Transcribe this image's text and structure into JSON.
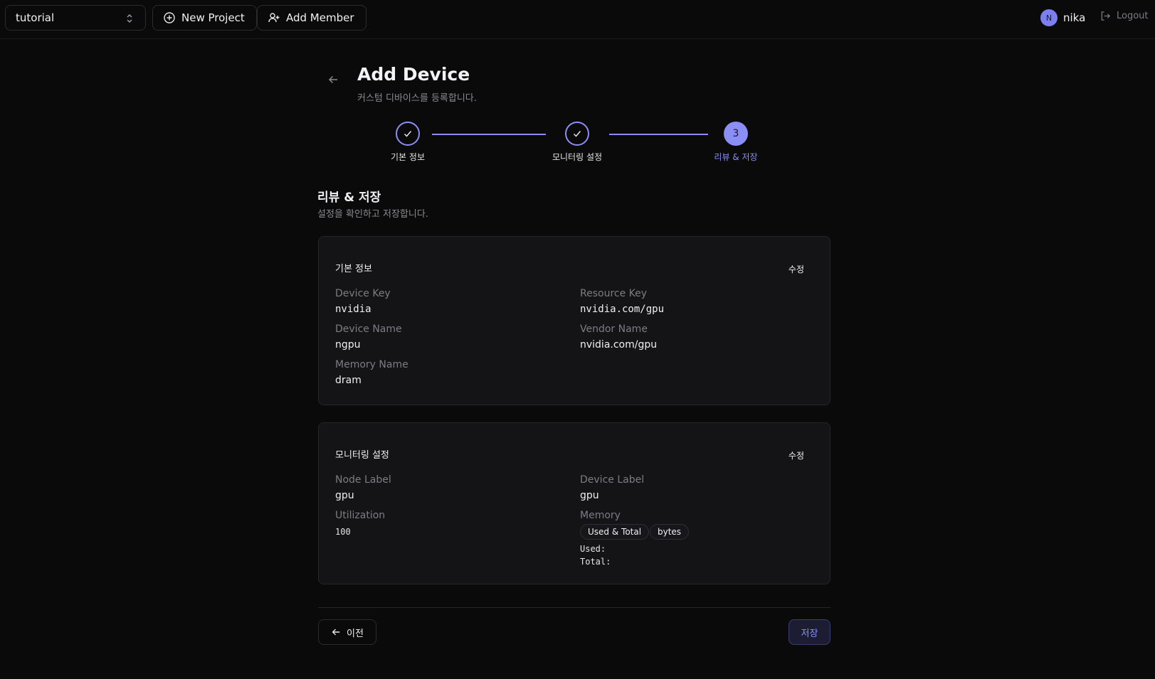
{
  "topbar": {
    "project": "tutorial",
    "new_project_label": "New Project",
    "add_member_label": "Add Member",
    "user_initial": "N",
    "user_name": "nika",
    "logout_label": "Logout"
  },
  "header": {
    "title": "Add Device",
    "subtitle": "커스텀 디바이스를 등록합니다."
  },
  "stepper": {
    "steps": [
      {
        "label": "기본 정보",
        "status": "done"
      },
      {
        "label": "모니터링 설정",
        "status": "done"
      },
      {
        "label": "리뷰 & 저장",
        "status": "active",
        "number": "3"
      }
    ]
  },
  "section": {
    "title": "리뷰 & 저장",
    "subtitle": "설정을 확인하고 저장합니다."
  },
  "basic": {
    "title": "기본 정보",
    "edit_label": "수정",
    "device_key_label": "Device Key",
    "device_key": "nvidia",
    "resource_key_label": "Resource Key",
    "resource_key": "nvidia.com/gpu",
    "device_name_label": "Device Name",
    "device_name": "ngpu",
    "vendor_name_label": "Vendor Name",
    "vendor_name": "nvidia.com/gpu",
    "memory_name_label": "Memory Name",
    "memory_name": "dram"
  },
  "monitoring": {
    "title": "모니터링 설정",
    "edit_label": "수정",
    "node_label_label": "Node Label",
    "node_label": "gpu",
    "device_label_label": "Device Label",
    "device_label": "gpu",
    "utilization_label": "Utilization",
    "utilization": "100",
    "memory_label": "Memory",
    "memory_mode": "Used & Total",
    "memory_unit": "bytes",
    "used_label": "Used:",
    "total_label": "Total:"
  },
  "footer": {
    "prev_label": "이전",
    "save_label": "저장"
  },
  "colors": {
    "accent": "#8b8ef5",
    "background": "#0a0a0b",
    "card": "#141417"
  }
}
